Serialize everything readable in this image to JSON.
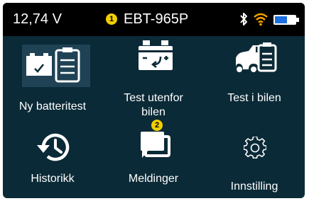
{
  "status": {
    "voltage": "12,74 V",
    "badge_1": "1",
    "device_name": "EBT-965P",
    "bluetooth_icon": "bluetooth-icon",
    "wifi_icon": "wifi-icon",
    "battery_level": 0.6,
    "colors": {
      "bar": "#000000",
      "badge": "#f2cf00",
      "battery_fill": "#1e6fe0",
      "wifi": "#f5a000"
    }
  },
  "menu": {
    "items": [
      {
        "label": "Ny batteritest",
        "icon": "battery-checklist-icon"
      },
      {
        "label_line1": "Test utenfor",
        "label_line2": "bilen",
        "icon": "battery-icon"
      },
      {
        "label": "Test i bilen",
        "icon": "car-checklist-icon"
      },
      {
        "label": "Historikk",
        "icon": "history-icon"
      },
      {
        "label": "Meldinger",
        "icon": "messages-icon",
        "badge": "2"
      },
      {
        "label": "Innstilling",
        "icon": "gear-icon"
      }
    ]
  },
  "colors": {
    "background": "#0b2a37",
    "text": "#ffffff"
  }
}
